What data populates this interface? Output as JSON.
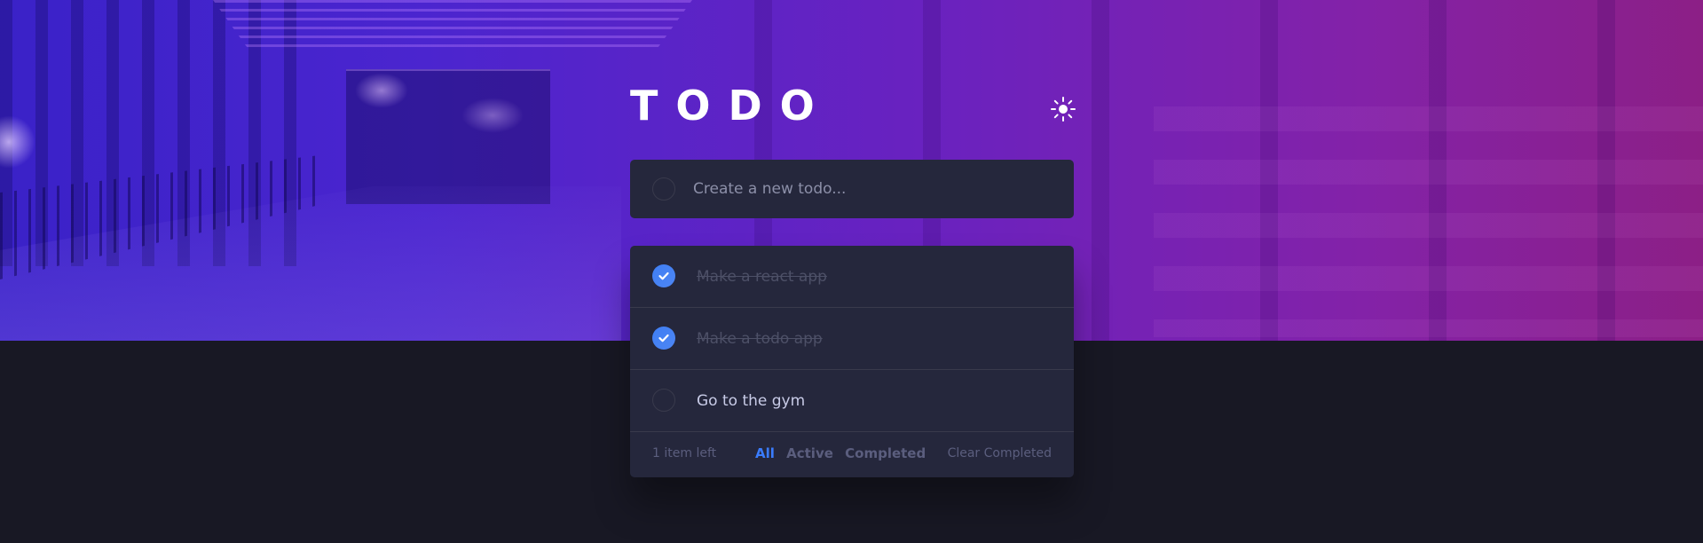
{
  "app": {
    "title": "TODO"
  },
  "theme_toggle": {
    "icon": "sun-icon"
  },
  "new_todo": {
    "placeholder": "Create a new todo...",
    "value": ""
  },
  "todos": [
    {
      "text": "Make a react app",
      "completed": true
    },
    {
      "text": "Make a todo app",
      "completed": true
    },
    {
      "text": "Go to the gym",
      "completed": false
    }
  ],
  "footer": {
    "items_left": "1 item left",
    "filters": [
      "All",
      "Active",
      "Completed"
    ],
    "active_filter": "All",
    "clear_label": "Clear Completed"
  },
  "colors": {
    "accent": "#3a7cfd",
    "card": "#25273c",
    "background": "#181824",
    "completed_text": "#4d5067",
    "text": "#c8cbe7"
  }
}
